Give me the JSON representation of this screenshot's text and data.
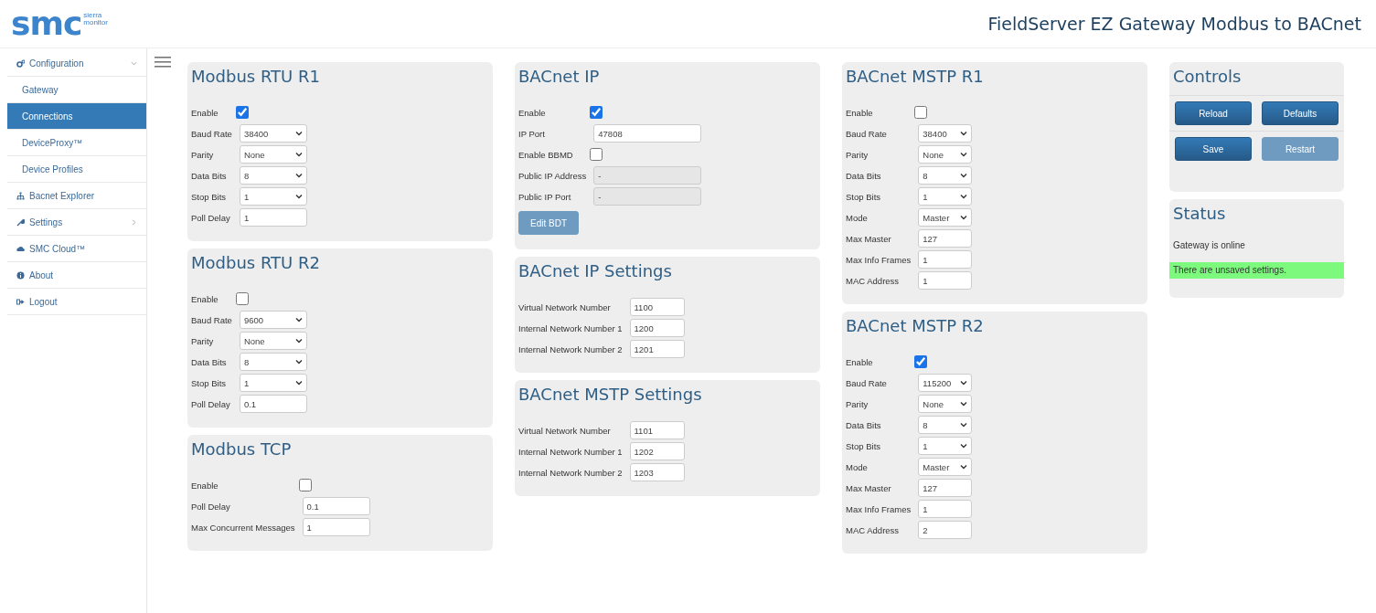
{
  "header": {
    "logo": {
      "mark": "smc",
      "tagline": [
        "sierra",
        "monitor"
      ]
    },
    "title": "FieldServer EZ Gateway Modbus to BACnet"
  },
  "sidebar": {
    "items": [
      {
        "label": "Configuration",
        "expanded": true,
        "selected": false,
        "children": [
          {
            "label": "Gateway",
            "selected": false
          },
          {
            "label": "Connections",
            "selected": true
          },
          {
            "label": "DeviceProxy™",
            "selected": false
          },
          {
            "label": "Device Profiles",
            "selected": false
          }
        ]
      },
      {
        "label": "Bacnet Explorer",
        "selected": false
      },
      {
        "label": "Settings",
        "expanded": false,
        "selected": false
      },
      {
        "label": "SMC Cloud™",
        "selected": false
      },
      {
        "label": "About",
        "selected": false
      },
      {
        "label": "Logout",
        "selected": false
      }
    ]
  },
  "columns": [
    {
      "panels": [
        {
          "title": "Modbus RTU R1",
          "kind": "serial",
          "fields": [
            {
              "label": "Enable",
              "kind": "checkbox",
              "checked": true
            },
            {
              "label": "Baud Rate",
              "kind": "select",
              "value": "38400"
            },
            {
              "label": "Parity",
              "kind": "select",
              "value": "None"
            },
            {
              "label": "Data Bits",
              "kind": "select",
              "value": "8"
            },
            {
              "label": "Stop Bits",
              "kind": "select",
              "value": "1"
            },
            {
              "label": "Poll Delay",
              "kind": "text",
              "value": "1",
              "disabled": false
            }
          ]
        },
        {
          "title": "Modbus RTU R2",
          "kind": "serial",
          "fields": [
            {
              "label": "Enable",
              "kind": "checkbox",
              "checked": false
            },
            {
              "label": "Baud Rate",
              "kind": "select",
              "value": "9600"
            },
            {
              "label": "Parity",
              "kind": "select",
              "value": "None"
            },
            {
              "label": "Data Bits",
              "kind": "select",
              "value": "8"
            },
            {
              "label": "Stop Bits",
              "kind": "select",
              "value": "1"
            },
            {
              "label": "Poll Delay",
              "kind": "text",
              "value": "0.1",
              "disabled": false
            }
          ]
        },
        {
          "title": "Modbus TCP",
          "kind": "tcp",
          "fields": [
            {
              "label": "Enable",
              "kind": "checkbox",
              "checked": false
            },
            {
              "label": "Poll Delay",
              "kind": "text",
              "value": "0.1",
              "disabled": false
            },
            {
              "label": "Max Concurrent Messages",
              "kind": "text",
              "value": "1",
              "disabled": false
            }
          ]
        }
      ]
    },
    {
      "panels": [
        {
          "title": "BACnet IP",
          "kind": "ip",
          "fields": [
            {
              "label": "Enable",
              "kind": "checkbox",
              "checked": true
            },
            {
              "label": "IP Port",
              "kind": "text",
              "value": "47808",
              "disabled": false
            },
            {
              "label": "Enable BBMD",
              "kind": "checkbox",
              "checked": false
            },
            {
              "label": "Public IP Address",
              "kind": "text",
              "value": "-",
              "disabled": true
            },
            {
              "label": "Public IP Port",
              "kind": "text",
              "value": "-",
              "disabled": true
            }
          ],
          "buttons": [
            {
              "label": "Edit BDT",
              "disabled": true
            }
          ]
        },
        {
          "title": "BACnet IP Settings",
          "kind": "network",
          "fields": [
            {
              "label": "Virtual Network Number",
              "kind": "text",
              "value": "1100",
              "disabled": false
            },
            {
              "label": "Internal Network Number 1",
              "kind": "text",
              "value": "1200",
              "disabled": false
            },
            {
              "label": "Internal Network Number 2",
              "kind": "text",
              "value": "1201",
              "disabled": false
            }
          ]
        },
        {
          "title": "BACnet MSTP Settings",
          "kind": "network",
          "fields": [
            {
              "label": "Virtual Network Number",
              "kind": "text",
              "value": "1101",
              "disabled": false
            },
            {
              "label": "Internal Network Number 1",
              "kind": "text",
              "value": "1202",
              "disabled": false
            },
            {
              "label": "Internal Network Number 2",
              "kind": "text",
              "value": "1203",
              "disabled": false
            }
          ]
        }
      ]
    },
    {
      "panels": [
        {
          "title": "BACnet MSTP R1",
          "kind": "mstp",
          "fields": [
            {
              "label": "Enable",
              "kind": "checkbox",
              "checked": false
            },
            {
              "label": "Baud Rate",
              "kind": "select",
              "value": "38400"
            },
            {
              "label": "Parity",
              "kind": "select",
              "value": "None"
            },
            {
              "label": "Data Bits",
              "kind": "select",
              "value": "8"
            },
            {
              "label": "Stop Bits",
              "kind": "select",
              "value": "1"
            },
            {
              "label": "Mode",
              "kind": "select",
              "value": "Master"
            },
            {
              "label": "Max Master",
              "kind": "text",
              "value": "127",
              "disabled": false
            },
            {
              "label": "Max Info Frames",
              "kind": "text",
              "value": "1",
              "disabled": false
            },
            {
              "label": "MAC Address",
              "kind": "text",
              "value": "1",
              "disabled": false
            }
          ]
        },
        {
          "title": "BACnet MSTP R2",
          "kind": "mstp",
          "fields": [
            {
              "label": "Enable",
              "kind": "checkbox",
              "checked": true
            },
            {
              "label": "Baud Rate",
              "kind": "select",
              "value": "115200"
            },
            {
              "label": "Parity",
              "kind": "select",
              "value": "None"
            },
            {
              "label": "Data Bits",
              "kind": "select",
              "value": "8"
            },
            {
              "label": "Stop Bits",
              "kind": "select",
              "value": "1"
            },
            {
              "label": "Mode",
              "kind": "select",
              "value": "Master"
            },
            {
              "label": "Max Master",
              "kind": "text",
              "value": "127",
              "disabled": false
            },
            {
              "label": "Max Info Frames",
              "kind": "text",
              "value": "1",
              "disabled": false
            },
            {
              "label": "MAC Address",
              "kind": "text",
              "value": "2",
              "disabled": false
            }
          ]
        }
      ]
    }
  ],
  "controls": {
    "title": "Controls",
    "buttons": [
      {
        "label": "Reload",
        "disabled": false
      },
      {
        "label": "Defaults",
        "disabled": false
      },
      {
        "label": "Save",
        "disabled": false
      },
      {
        "label": "Restart",
        "disabled": true
      }
    ]
  },
  "status": {
    "title": "Status",
    "messages": [
      {
        "text": "Gateway is online",
        "kind": "info"
      },
      {
        "text": "There are unsaved settings.",
        "kind": "warning"
      }
    ]
  }
}
